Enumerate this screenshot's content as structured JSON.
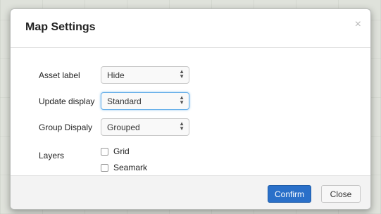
{
  "dialog": {
    "title": "Map Settings",
    "close_glyph": "×",
    "close_icon": "close-icon"
  },
  "fields": [
    {
      "label": "Asset label",
      "value": "Hide",
      "focused": false
    },
    {
      "label": "Update display",
      "value": "Standard",
      "focused": true
    },
    {
      "label": "Group Dispaly",
      "value": "Grouped",
      "focused": false
    }
  ],
  "layers": {
    "label": "Layers",
    "options": [
      {
        "label": "Grid",
        "checked": false
      },
      {
        "label": "Seamark",
        "checked": false
      }
    ]
  },
  "select_arrows": "▲▼",
  "buttons": {
    "confirm": "Confirm",
    "close": "Close"
  },
  "colors": {
    "primary": "#2a70c9",
    "focus": "#66afe9"
  }
}
